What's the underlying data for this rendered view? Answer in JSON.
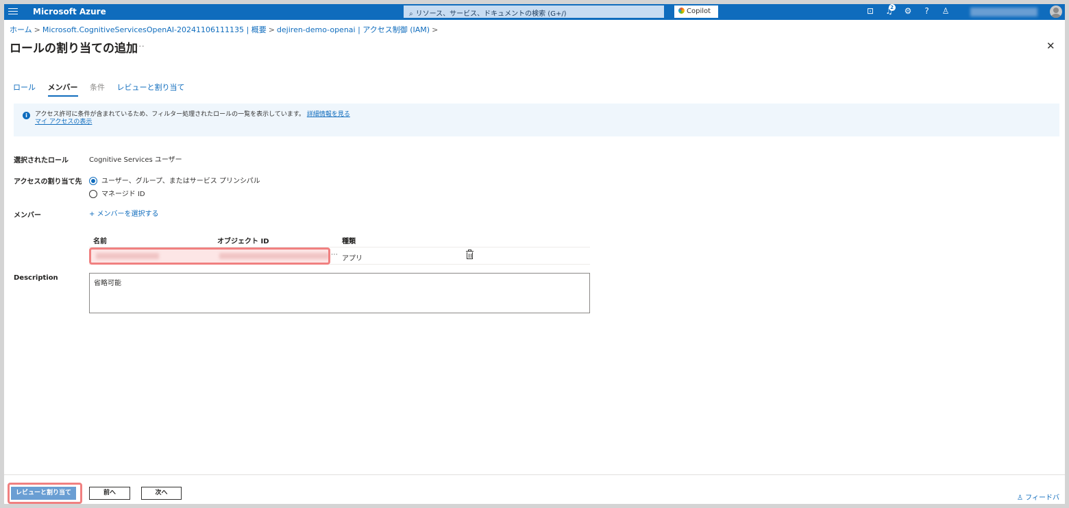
{
  "topbar": {
    "brand": "Microsoft Azure",
    "search_placeholder": "リソース、サービス、ドキュメントの検索 (G+/)",
    "copilot_label": "Copilot",
    "notification_count": "2"
  },
  "breadcrumb": [
    "ホーム",
    "Microsoft.CognitiveServicesOpenAI-20241106111135 | 概要",
    "dejiren-demo-openai | アクセス制御 (IAM)"
  ],
  "page": {
    "title": "ロールの割り当ての追加",
    "more": "···",
    "close": "✕"
  },
  "tabs": [
    {
      "label": "ロール"
    },
    {
      "label": "メンバー"
    },
    {
      "label": "条件"
    },
    {
      "label": "レビューと割り当て"
    }
  ],
  "info": {
    "text": "アクセス許可に条件が含まれているため、フィルター処理されたロールの一覧を表示しています。",
    "link": "詳細情報を見る",
    "link2": "マイ アクセスの表示"
  },
  "form": {
    "selected_role_label": "選択されたロール",
    "selected_role_value": "Cognitive Services ユーザー",
    "assign_to_label": "アクセスの割り当て先",
    "assign_option_1": "ユーザー、グループ、またはサービス プリンシパル",
    "assign_option_2": "マネージド ID",
    "members_label": "メンバー",
    "select_members": "+ メンバーを選択する",
    "description_label": "Description",
    "description_value": "省略可能"
  },
  "members_table": {
    "headers": {
      "name": "名前",
      "object_id": "オブジェクト ID",
      "type": "種類"
    },
    "rows": [
      {
        "type": "アプリ"
      }
    ]
  },
  "footer": {
    "review_assign": "レビューと割り当て",
    "prev": "前へ",
    "next": "次へ",
    "feedback": "フィードバック"
  }
}
